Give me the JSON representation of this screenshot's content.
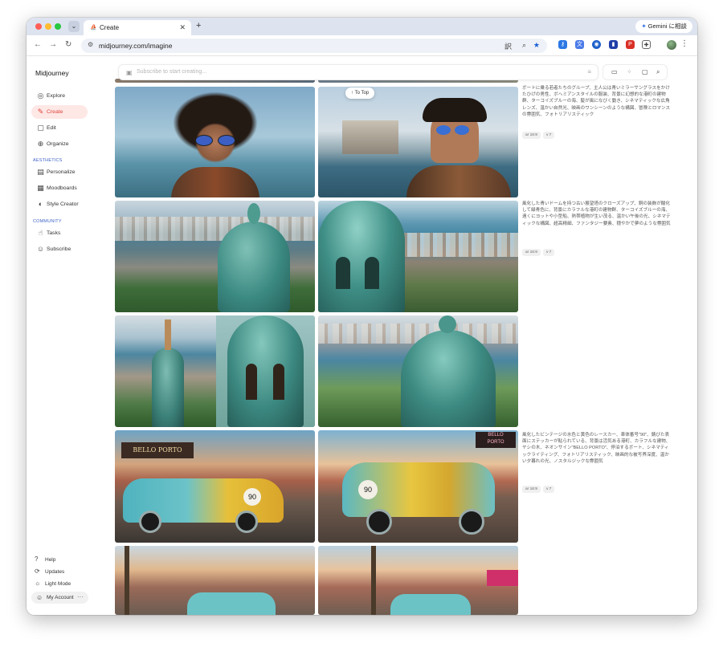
{
  "browser": {
    "tab_title": "Create",
    "url": "midjourney.com/imagine",
    "gemini_button": "Gemini に相談"
  },
  "sidebar": {
    "brand": "Midjourney",
    "items": [
      {
        "label": "Explore",
        "icon": "compass-icon"
      },
      {
        "label": "Create",
        "icon": "brush-icon",
        "active": true
      },
      {
        "label": "Edit",
        "icon": "edit-icon"
      },
      {
        "label": "Organize",
        "icon": "grid-globe-icon"
      }
    ],
    "aesthetics_label": "AESTHETICS",
    "aesthetics_items": [
      {
        "label": "Personalize",
        "icon": "personalize-icon"
      },
      {
        "label": "Moodboards",
        "icon": "moodboard-icon"
      },
      {
        "label": "Style Creator",
        "icon": "palette-icon"
      }
    ],
    "community_label": "COMMUNITY",
    "community_items": [
      {
        "label": "Tasks",
        "icon": "thumbs-up-icon"
      },
      {
        "label": "Subscribe",
        "icon": "user-circle-icon"
      }
    ],
    "bottom_items": [
      {
        "label": "Help",
        "icon": "help-icon"
      },
      {
        "label": "Updates",
        "icon": "updates-icon"
      },
      {
        "label": "Light Mode",
        "icon": "sun-icon"
      }
    ],
    "account_label": "My Account"
  },
  "search": {
    "placeholder": "Subscribe to start creating..."
  },
  "to_top": "To Top",
  "prompts": [
    {
      "text": "ボートに乗る若者たちのグループ、主人公は青いミラーサングラスをかけたひげの男性、ボヘミアンスタイルの服装、背景に幻想的な港町の建物群、ターコイズブルーの海、髪が風になびく動き、シネマティックな広角レンズ、温かい自然光、映画のワンシーンのような構図、冒険とロマンスの雰囲気、フォトリアリスティック",
      "ar": "ar 16:9",
      "v": "v 7"
    },
    {
      "text": "風化した青いドームを持つ古い展望塔のクローズアップ、銅の装飾が酸化して緑青色に、背景にカラフルな港町の建物群、ターコイズブルーの海、遠くにヨットや小型船、熱帯植物が生い茂る、温かい午後の光、シネマティックな構図、超高精細、ファンタジー要素、穏やかで夢のような雰囲気",
      "ar": "ar 16:9",
      "v": "v 7"
    },
    {
      "text": "風化したビンテージの水色と黄色のレースカー、車体番号\"90\"、錆びた表面にステッカーが貼られている、背景は活気ある港町、カラフルな建物、ヤシの木、ネオンサイン\"BELLO PORTO\"、停泊するボート、シネマティックライティング、フォトリアリスティック、映画的な被写界深度、温かい夕暮れの光、ノスタルジックな雰囲気",
      "ar": "ar 16:9",
      "v": "v 7"
    }
  ],
  "colors": {
    "accent": "#e0433a",
    "section_label": "#3f64c7"
  }
}
